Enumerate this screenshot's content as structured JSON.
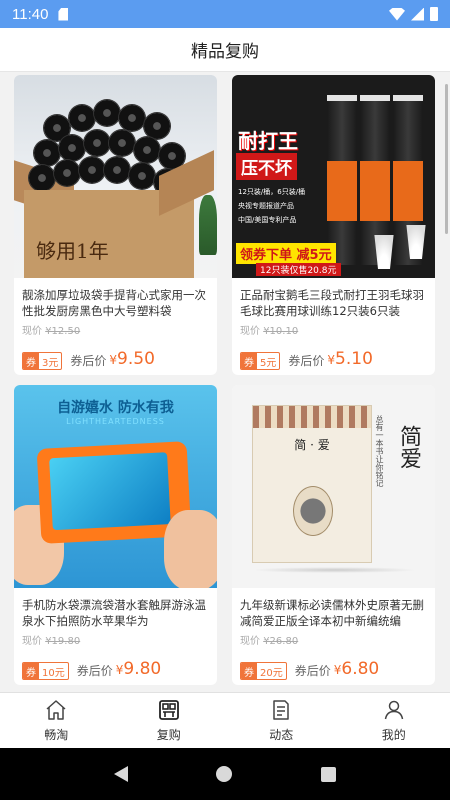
{
  "status_bar": {
    "time": "11:40"
  },
  "header": {
    "title": "精品复购"
  },
  "labels": {
    "original_prefix": "现价",
    "after_label": "券后价",
    "coupon_tag": "券",
    "currency": "¥"
  },
  "products": [
    {
      "title": "靓涤加厚垃圾袋手提背心式家用一次性批发厨房黑色中大号塑料袋",
      "original_price": "¥12.50",
      "coupon_value": "3元",
      "after_price": "9.50",
      "image_text": "够用1年"
    },
    {
      "title": "正品耐宝鹅毛三段式耐打王羽毛球羽毛球比赛用球训练12只装6只装",
      "original_price": "¥10.10",
      "coupon_value": "5元",
      "after_price": "5.10",
      "image_text": {
        "brand": "耐打王",
        "headline": "压不坏",
        "features": [
          "12只装/桶，6只装/桶",
          "央视专题报道产品",
          "中国/美国专利产品"
        ],
        "promo": "领券下单 减5元",
        "promo_sub": "12只装仅售20.8元"
      }
    },
    {
      "title": "手机防水袋漂流袋潜水套触屏游泳温泉水下拍照防水苹果华为",
      "original_price": "¥19.80",
      "coupon_value": "10元",
      "after_price": "9.80",
      "image_text": {
        "headline": "自游嬉水 防水有我",
        "sub": "LIGHTHEARTEDNESS"
      }
    },
    {
      "title": "九年级新课标必读儒林外史原著无删减简爱正版全译本初中新编统编",
      "original_price": "¥26.80",
      "coupon_value": "20元",
      "after_price": "6.80",
      "image_text": {
        "book_title": "简 · 爱",
        "spine_title": "简爱",
        "side_text": "总有一本书让你铭记"
      }
    }
  ],
  "bottom_nav": [
    {
      "label": "畅淘",
      "icon": "home-icon"
    },
    {
      "label": "复购",
      "icon": "grid-icon"
    },
    {
      "label": "动态",
      "icon": "document-icon"
    },
    {
      "label": "我的",
      "icon": "person-icon"
    }
  ],
  "colors": {
    "status_bar": "#5b9cf0",
    "accent": "#f26a2a",
    "coupon": "#f0743a"
  }
}
